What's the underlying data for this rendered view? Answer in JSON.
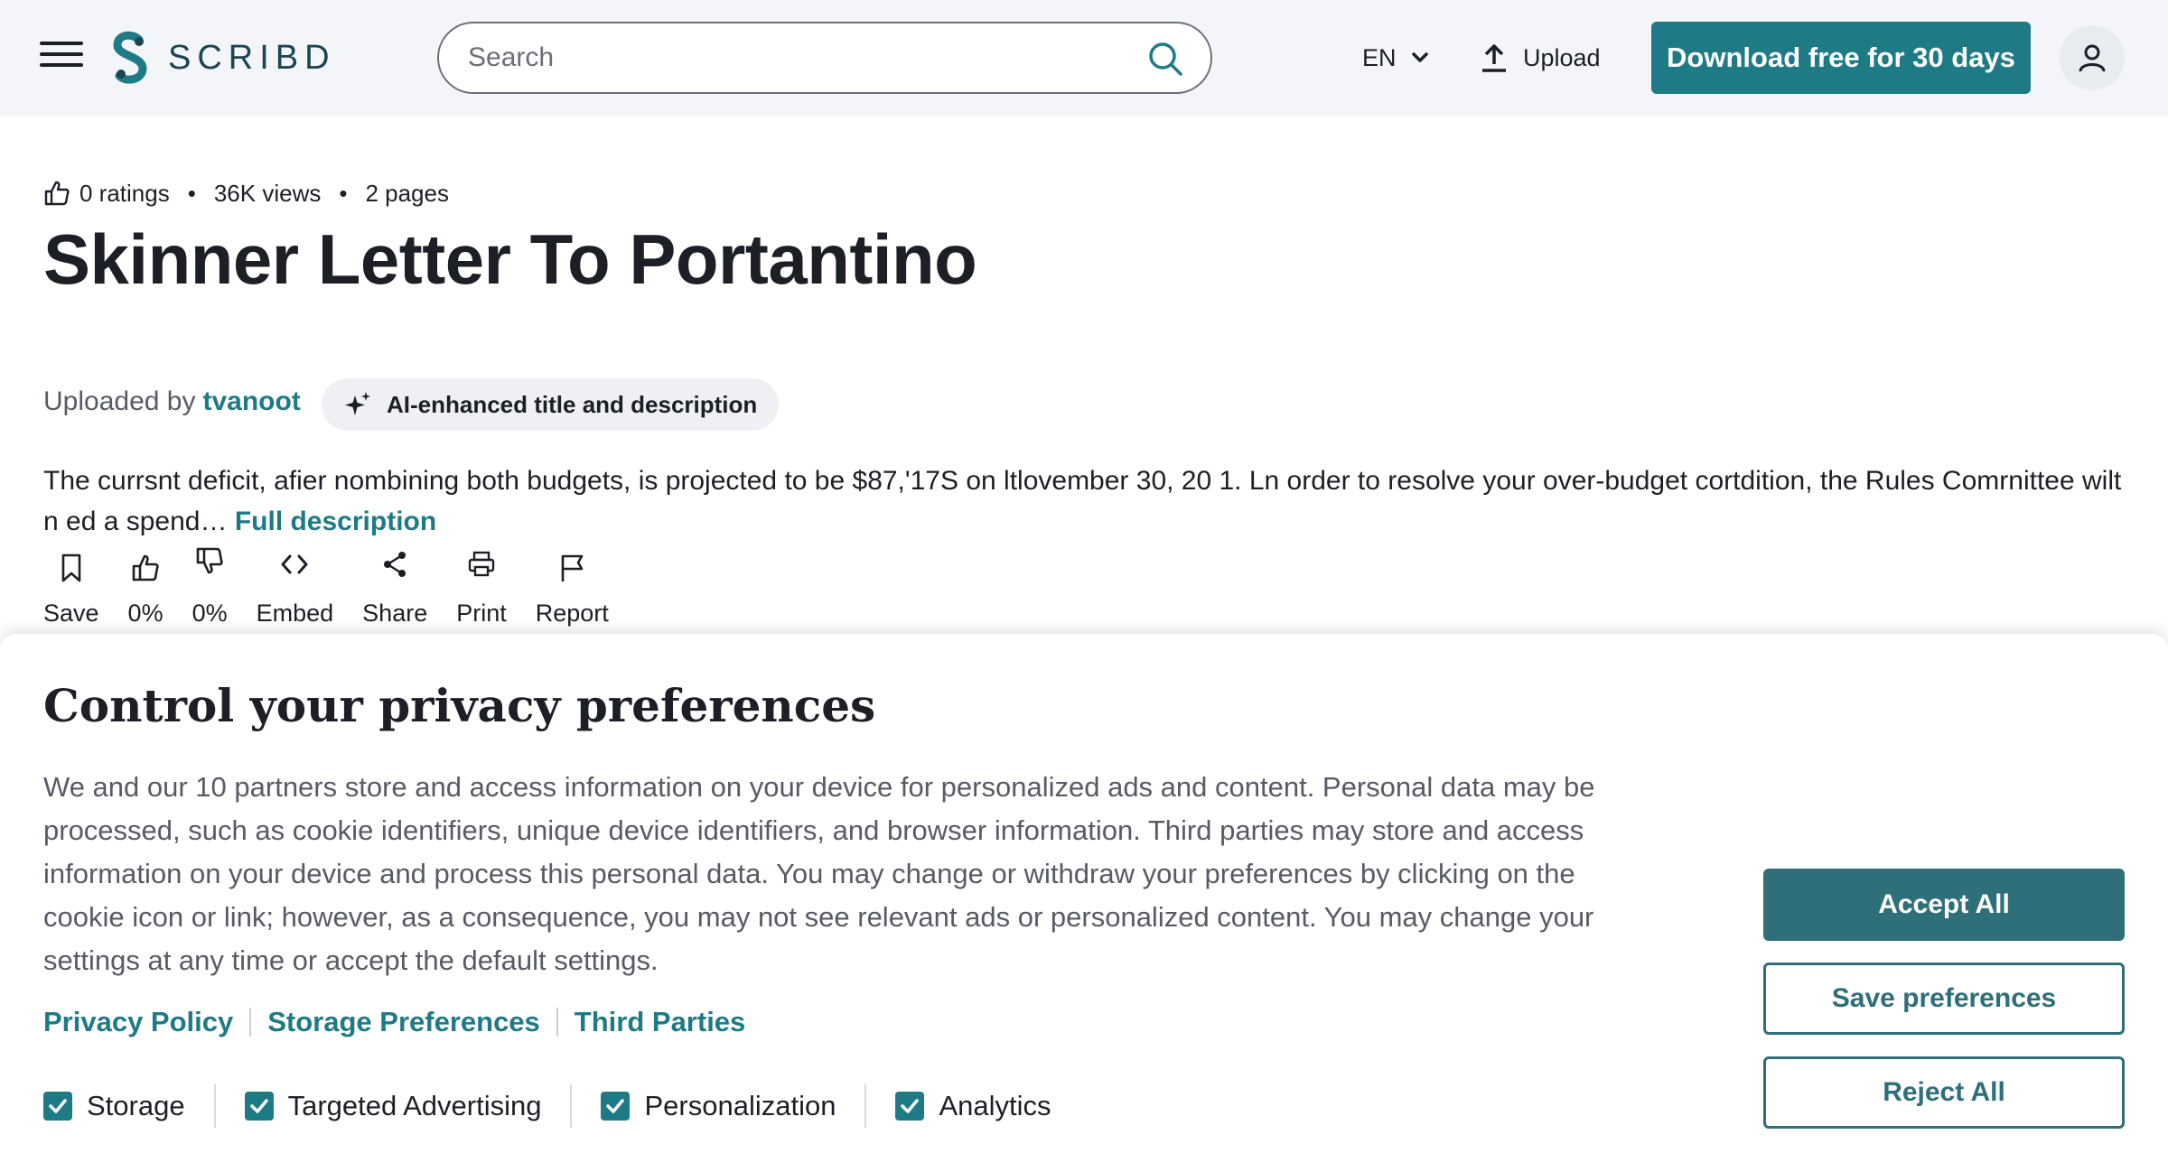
{
  "header": {
    "logo_text": "SCRIBD",
    "search_placeholder": "Search",
    "language": "EN",
    "upload_label": "Upload",
    "download_label": "Download free for 30 days"
  },
  "document": {
    "ratings": "0 ratings",
    "views": "36K views",
    "pages": "2 pages",
    "title": "Skinner Letter To Portantino",
    "uploaded_by_label": "Uploaded by",
    "uploader": "tvanoot",
    "ai_badge": "AI-enhanced title and description",
    "description": "The currsnt deficit, afier nombining both budgets, is projected to be $87,'17S on ltlovember 30, 20 1. Ln order to resolve your over-budget cortdition, the Rules Comrnittee wilt n ed a spend…",
    "full_description_link": "Full description"
  },
  "actions": [
    {
      "label": "Save",
      "icon": "bookmark-icon"
    },
    {
      "label": "0%",
      "icon": "thumbs-up-icon"
    },
    {
      "label": "0%",
      "icon": "thumbs-down-icon"
    },
    {
      "label": "Embed",
      "icon": "embed-icon"
    },
    {
      "label": "Share",
      "icon": "share-icon"
    },
    {
      "label": "Print",
      "icon": "print-icon"
    },
    {
      "label": "Report",
      "icon": "flag-icon"
    }
  ],
  "privacy": {
    "title": "Control your privacy preferences",
    "text": "We and our 10 partners store and access information on your device for personalized ads and content. Personal data may be processed, such as cookie identifiers, unique device identifiers, and browser information. Third parties may store and access information on your device and process this personal data. You may change or withdraw your preferences by clicking on the cookie icon or link; however, as a consequence, you may not see relevant ads or personalized content. You may change your settings at any time or accept the default settings.",
    "links": [
      "Privacy Policy",
      "Storage Preferences",
      "Third Parties"
    ],
    "consents": [
      "Storage",
      "Targeted Advertising",
      "Personalization",
      "Analytics"
    ],
    "accept_all": "Accept All",
    "save_preferences": "Save preferences",
    "reject_all": "Reject All"
  },
  "colors": {
    "brand": "#1e7b85",
    "button_dark": "#2e6f7a",
    "header_bg": "#f3f5f9"
  }
}
